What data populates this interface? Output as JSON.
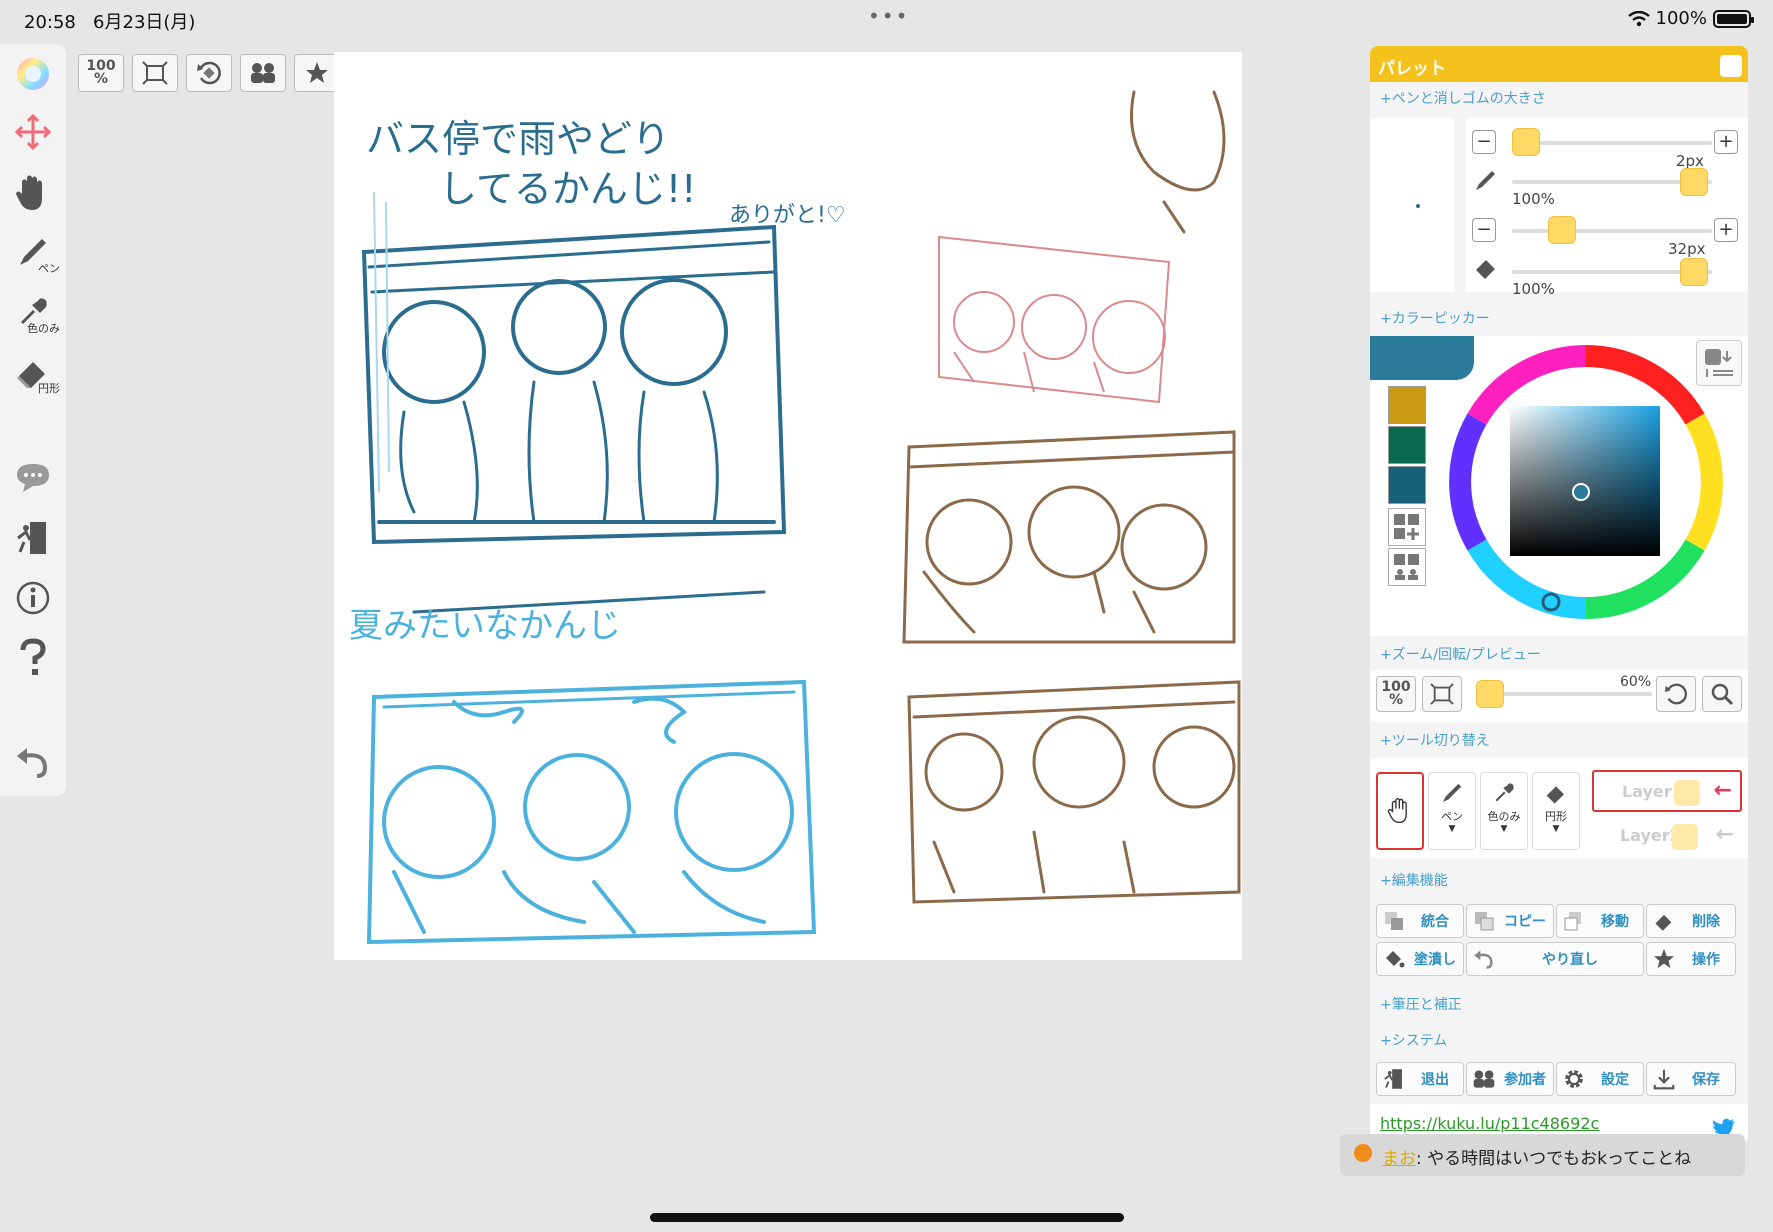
{
  "status": {
    "time": "20:58",
    "date": "6月23日(月)",
    "battery": "100%"
  },
  "left_tools": {
    "pen": "ペン",
    "eyedropper": "色のみ",
    "eraser": "円形"
  },
  "top_toolbar": {
    "zoom": "100",
    "zoom_unit": "%"
  },
  "canvas": {
    "text1a": "バス停で雨やどり",
    "text1b": "してるかんじ!!",
    "text1c": "ありがと!♡",
    "text2": "夏みたいなかんじ"
  },
  "palette": {
    "title": "パレット",
    "sec_size": "+ペンと消しゴムの大きさ",
    "pen_size": "2px",
    "pen_opacity": "100%",
    "eraser_size": "32px",
    "eraser_opacity": "100%",
    "sec_color": "+カラーピッカー",
    "swatch_colors": [
      "#c89b12",
      "#0a6a4e",
      "#17607a"
    ],
    "current_color": "#2a7a9a",
    "sec_zoom": "+ズーム/回転/プレビュー",
    "zoom_btn": "100",
    "zoom_unit": "%",
    "preview_pct": "60%",
    "sec_tools": "+ツール切り替え",
    "tools": {
      "pen": "ペン",
      "eyedropper": "色のみ",
      "eraser": "円形"
    },
    "layers": [
      "Layer1",
      "Layer2"
    ],
    "sec_edit": "+編集機能",
    "edit": {
      "merge": "統合",
      "copy": "コピー",
      "move": "移動",
      "delete": "削除",
      "fill": "塗潰し",
      "redo": "やり直し",
      "operate": "操作"
    },
    "sec_pressure": "+筆圧と補正",
    "sec_system": "+システム",
    "system": {
      "exit": "退出",
      "members": "参加者",
      "settings": "設定",
      "save": "保存"
    },
    "url": "https://kuku.lu/p11c48692c"
  },
  "chat": {
    "name": "まお",
    "message": ": やる時間はいつでもおkってことね"
  }
}
